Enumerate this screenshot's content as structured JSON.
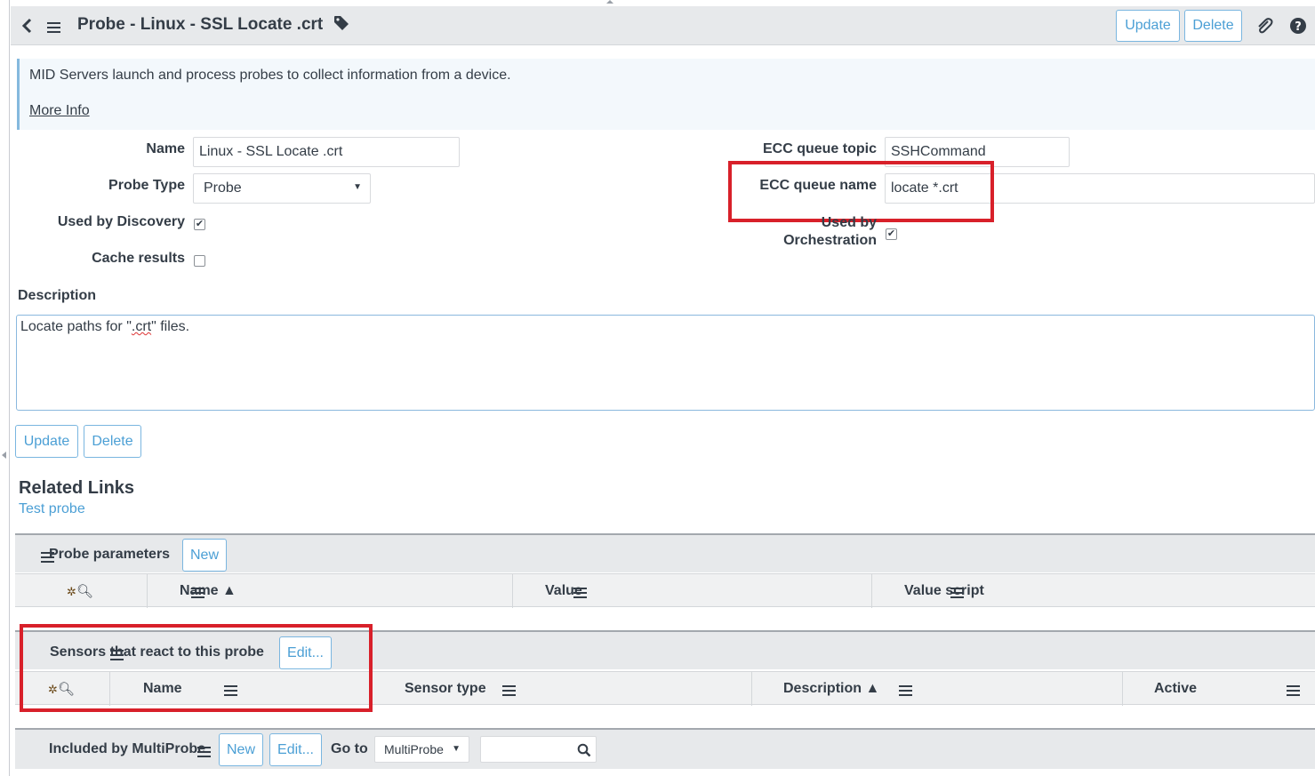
{
  "header": {
    "title": "Probe - Linux - SSL Locate .crt",
    "update_label": "Update",
    "delete_label": "Delete"
  },
  "info": {
    "text": "MID Servers launch and process probes to collect information from a device.",
    "more_info": "More Info"
  },
  "form": {
    "name_label": "Name",
    "name_value": "Linux - SSL Locate .crt",
    "probe_type_label": "Probe Type",
    "probe_type_value": "Probe",
    "used_by_discovery_label": "Used by Discovery",
    "used_by_discovery_checked": true,
    "cache_results_label": "Cache results",
    "cache_results_checked": false,
    "ecc_topic_label": "ECC queue topic",
    "ecc_topic_value": "SSHCommand",
    "ecc_name_label": "ECC queue name",
    "ecc_name_value": "locate *.crt",
    "used_by_orch_label_1": "Used by",
    "used_by_orch_label_2": "Orchestration",
    "used_by_orch_checked": true,
    "description_label": "Description",
    "description_pre": "Locate paths for \"",
    "description_mid": ".crt",
    "description_post": "\" files."
  },
  "bottom_buttons": {
    "update_label": "Update",
    "delete_label": "Delete"
  },
  "related_links": {
    "title": "Related Links",
    "test_probe": "Test probe"
  },
  "probe_parameters": {
    "title": "Probe parameters",
    "new_label": "New",
    "columns": [
      "Name ▲",
      "Value",
      "Value script"
    ]
  },
  "sensors": {
    "title": "Sensors that react to this probe",
    "edit_label": "Edit...",
    "columns": [
      "Name",
      "Sensor type",
      "Description ▲",
      "Active"
    ]
  },
  "multiprobe": {
    "title": "Included by MultiProbe",
    "new_label": "New",
    "edit_label": "Edit...",
    "goto_label": "Go to",
    "goto_select": "MultiProbe"
  },
  "colors": {
    "accent": "#4b9fd5",
    "highlight": "#d8202a",
    "header_bg": "#e7e9eb"
  }
}
